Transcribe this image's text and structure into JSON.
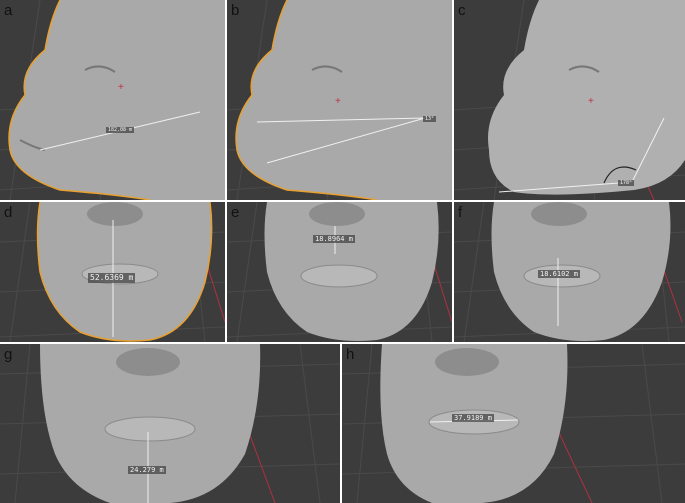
{
  "panels": [
    {
      "label": "a",
      "measurement": "182.08 m"
    },
    {
      "label": "b",
      "measurement": "13°"
    },
    {
      "label": "c",
      "measurement": "178°"
    },
    {
      "label": "d",
      "measurement": "52.6369 m"
    },
    {
      "label": "e",
      "measurement": "18.8964 m"
    },
    {
      "label": "f",
      "measurement": "18.6102 m"
    },
    {
      "label": "g",
      "measurement": "24.279 m"
    },
    {
      "label": "h",
      "measurement": "37.9189 m"
    }
  ],
  "colors": {
    "viewport_bg": "#3c3c3c",
    "grid": "#4a4a4a",
    "mesh": "#a9a9a9",
    "outline": "#e8a030",
    "axis_red": "#b03040",
    "measure_line": "#f0f0f0"
  }
}
